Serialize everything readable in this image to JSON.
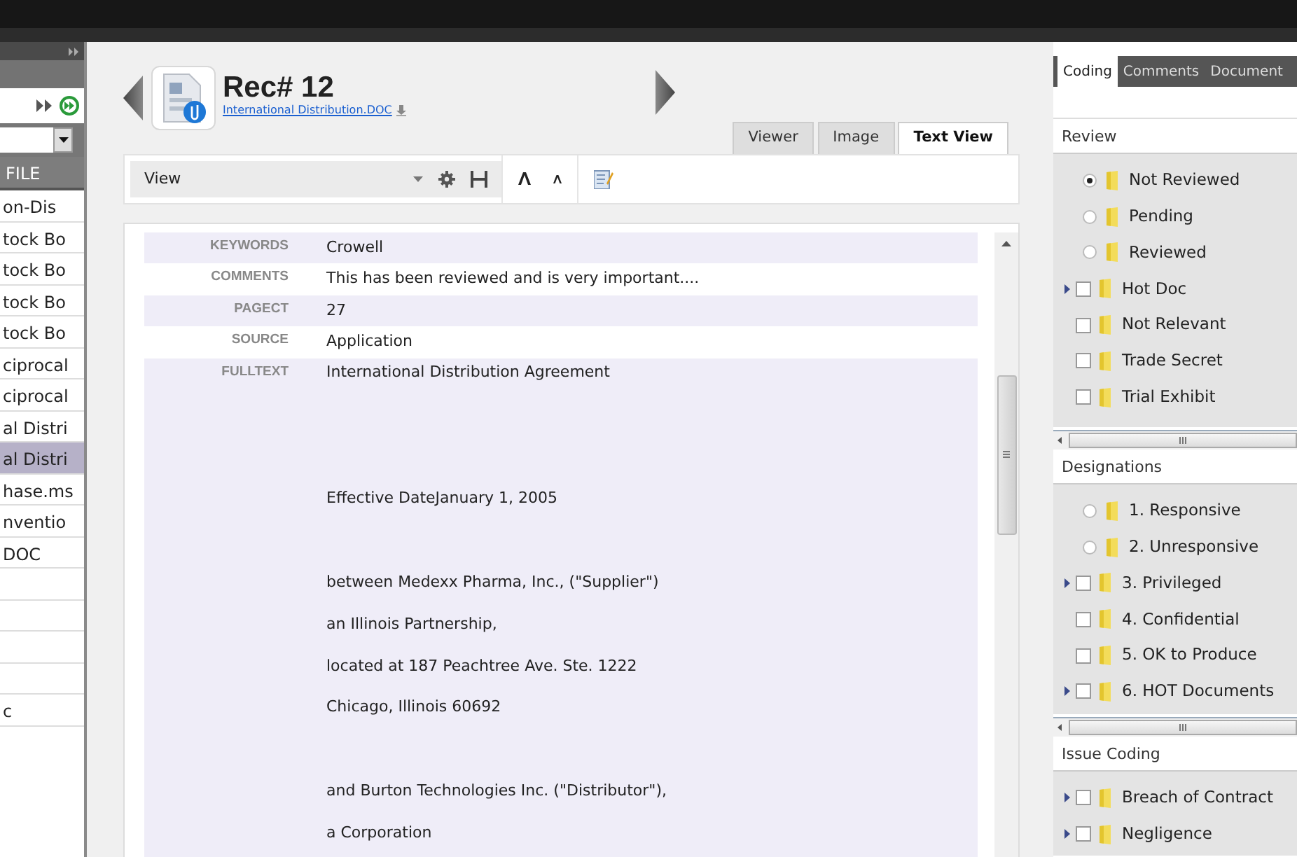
{
  "left_panel": {
    "column_header": "FILE",
    "rows": [
      {
        "text": "on-Dis",
        "selected": false
      },
      {
        "text": "tock Bo",
        "selected": false
      },
      {
        "text": "tock Bo",
        "selected": false
      },
      {
        "text": "tock Bo",
        "selected": false
      },
      {
        "text": "tock Bo",
        "selected": false
      },
      {
        "text": "ciprocal",
        "selected": false
      },
      {
        "text": "ciprocal",
        "selected": false
      },
      {
        "text": "al Distri",
        "selected": false
      },
      {
        "text": "al Distri",
        "selected": true
      },
      {
        "text": "hase.ms",
        "selected": false
      },
      {
        "text": "nventio",
        "selected": false
      },
      {
        "text": "DOC",
        "selected": false
      },
      {
        "selected": false
      },
      {
        "selected": false
      },
      {
        "selected": false
      },
      {
        "selected": false
      },
      {
        "text": "c",
        "selected": false
      }
    ]
  },
  "record": {
    "title": "Rec# 12",
    "file_link": "International Distribution.DOC"
  },
  "tabs": [
    {
      "label": "Viewer",
      "selected": false
    },
    {
      "label": "Image",
      "selected": false
    },
    {
      "label": "Text View",
      "selected": true
    }
  ],
  "toolbar": {
    "view_select": "View"
  },
  "fields": [
    {
      "label": "KEYWORDS",
      "value": "Crowell"
    },
    {
      "label": "COMMENTS",
      "value": "This has been reviewed and is very important...."
    },
    {
      "label": "PAGECT",
      "value": "27"
    },
    {
      "label": "SOURCE",
      "value": "Application"
    },
    {
      "label": "FULLTEXT",
      "lines": [
        "International Distribution Agreement",
        "Effective DateJanuary 1, 2005",
        "between Medexx Pharma, Inc., (\"Supplier\")",
        "an Illinois Partnership,",
        "located at 187 Peachtree Ave. Ste. 1222",
        "Chicago, Illinois  60692",
        "and Burton Technologies Inc. (\"Distributor\"),",
        "a Corporation"
      ]
    }
  ],
  "coding_panel": {
    "tabs": [
      {
        "label": "Coding",
        "selected": true
      },
      {
        "label": "Comments",
        "selected": false
      },
      {
        "label": "Document",
        "selected": false
      }
    ],
    "sections": [
      {
        "title": "Review",
        "items": [
          {
            "label": "Not Reviewed",
            "kind": "radio",
            "checked": true,
            "expandable": false
          },
          {
            "label": "Pending",
            "kind": "radio",
            "checked": false,
            "expandable": false
          },
          {
            "label": "Reviewed",
            "kind": "radio",
            "checked": false,
            "expandable": false
          },
          {
            "label": "Hot Doc",
            "kind": "checkbox",
            "checked": false,
            "expandable": true
          },
          {
            "label": "Not Relevant",
            "kind": "checkbox",
            "checked": false,
            "expandable": false
          },
          {
            "label": "Trade Secret",
            "kind": "checkbox",
            "checked": false,
            "expandable": false
          },
          {
            "label": "Trial Exhibit",
            "kind": "checkbox",
            "checked": false,
            "expandable": false
          }
        ]
      },
      {
        "title": "Designations",
        "items": [
          {
            "label": "1. Responsive",
            "kind": "radio",
            "checked": false,
            "expandable": false
          },
          {
            "label": "2. Unresponsive",
            "kind": "radio",
            "checked": false,
            "expandable": false
          },
          {
            "label": "3. Privileged",
            "kind": "checkbox",
            "checked": false,
            "expandable": true
          },
          {
            "label": "4. Confidential",
            "kind": "checkbox",
            "checked": false,
            "expandable": false
          },
          {
            "label": "5. OK to Produce",
            "kind": "checkbox",
            "checked": false,
            "expandable": false
          },
          {
            "label": "6. HOT Documents",
            "kind": "checkbox",
            "checked": false,
            "expandable": true
          }
        ]
      },
      {
        "title": "Issue Coding",
        "items": [
          {
            "label": "Breach of Contract",
            "kind": "checkbox",
            "checked": false,
            "expandable": true
          },
          {
            "label": "Negligence",
            "kind": "checkbox",
            "checked": false,
            "expandable": true
          }
        ]
      }
    ]
  }
}
